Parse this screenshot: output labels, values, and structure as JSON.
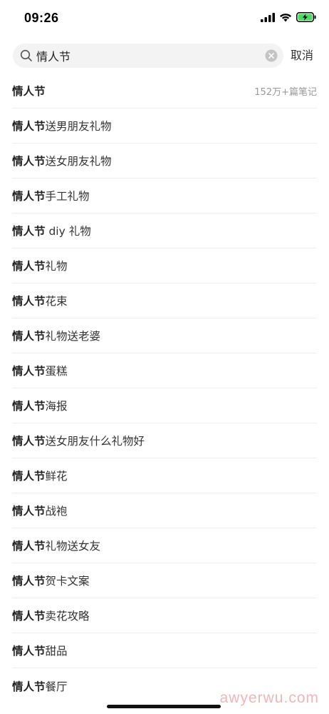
{
  "status_bar": {
    "time": "09:26"
  },
  "search": {
    "query": "情人节",
    "cancel_label": "取消"
  },
  "suggestions": [
    {
      "keyword": "情人节",
      "suffix": "",
      "meta": "152万+篇笔记"
    },
    {
      "keyword": "情人节",
      "suffix": "送男朋友礼物"
    },
    {
      "keyword": "情人节",
      "suffix": "送女朋友礼物"
    },
    {
      "keyword": "情人节",
      "suffix": "手工礼物"
    },
    {
      "keyword": "情人节",
      "suffix": " diy 礼物"
    },
    {
      "keyword": "情人节",
      "suffix": "礼物"
    },
    {
      "keyword": "情人节",
      "suffix": "花束"
    },
    {
      "keyword": "情人节",
      "suffix": "礼物送老婆"
    },
    {
      "keyword": "情人节",
      "suffix": "蛋糕"
    },
    {
      "keyword": "情人节",
      "suffix": "海报"
    },
    {
      "keyword": "情人节",
      "suffix": "送女朋友什么礼物好"
    },
    {
      "keyword": "情人节",
      "suffix": "鲜花"
    },
    {
      "keyword": "情人节",
      "suffix": "战袍"
    },
    {
      "keyword": "情人节",
      "suffix": "礼物送女友"
    },
    {
      "keyword": "情人节",
      "suffix": "贺卡文案"
    },
    {
      "keyword": "情人节",
      "suffix": "卖花攻略"
    },
    {
      "keyword": "情人节",
      "suffix": "甜品"
    },
    {
      "keyword": "情人节",
      "suffix": "餐厅"
    }
  ],
  "watermark": "awyerwu.com",
  "colors": {
    "battery_fill": "#4cd964",
    "watermark": "#f2b6b6"
  }
}
